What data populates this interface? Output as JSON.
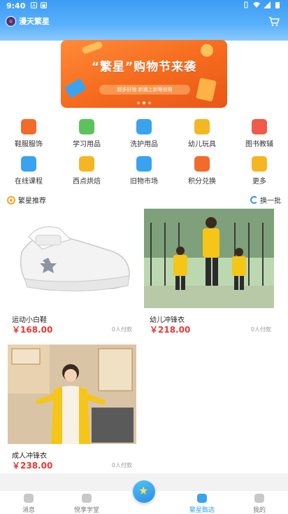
{
  "status_bar": {
    "time": "9:40"
  },
  "app": {
    "title": "漫天繁星"
  },
  "banner": {
    "title": "“繁星”购物节来袭",
    "subtitle": "超多好物  新潮上新等你购",
    "dot_count": 3,
    "active_dot": 1
  },
  "categories": [
    {
      "label": "鞋服服饰",
      "color": "#f26b2a"
    },
    {
      "label": "学习用品",
      "color": "#5cc35c"
    },
    {
      "label": "洗护用品",
      "color": "#3aa3f0"
    },
    {
      "label": "幼儿玩具",
      "color": "#f5b623"
    },
    {
      "label": "图书教辅",
      "color": "#ef5a4a"
    },
    {
      "label": "在线课程",
      "color": "#3aa3f0"
    },
    {
      "label": "西点烘焙",
      "color": "#f5b623"
    },
    {
      "label": "旧物市场",
      "color": "#3aa3f0"
    },
    {
      "label": "积分兑换",
      "color": "#f26b2a"
    },
    {
      "label": "更多",
      "color": "#f5b623"
    }
  ],
  "section": {
    "title": "繁星推荐",
    "refresh": "换一批"
  },
  "products": [
    {
      "name": "运动小白鞋",
      "price": "￥168.00",
      "buyers": "0人付款"
    },
    {
      "name": "幼儿冲锋衣",
      "price": "￥218.00",
      "buyers": "0人付款"
    },
    {
      "name": "成人冲锋衣",
      "price": "￥238.00",
      "buyers": "0人付款"
    }
  ],
  "bottom_nav": [
    {
      "label": "消息"
    },
    {
      "label": "悦享学堂"
    },
    {
      "label": "繁星甄选",
      "active": true
    },
    {
      "label": "我的"
    }
  ],
  "colors": {
    "accent": "#3aa3f0",
    "price": "#e53935",
    "banner": "#f56a1c"
  }
}
